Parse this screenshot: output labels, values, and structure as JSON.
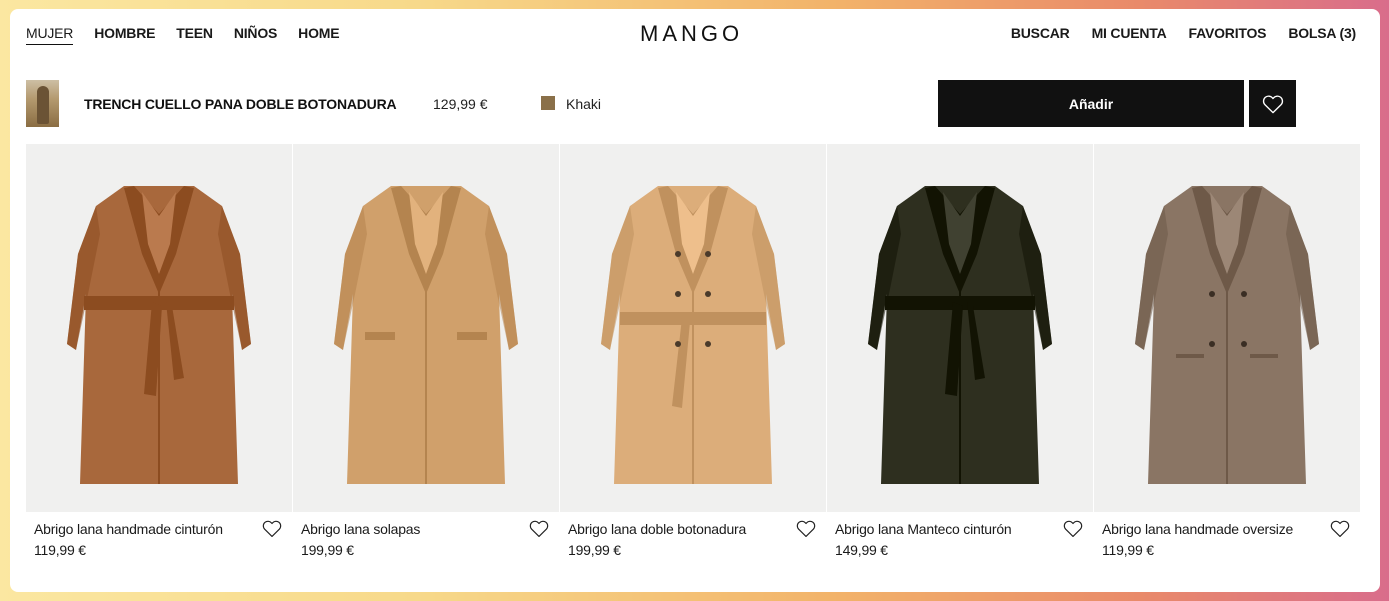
{
  "nav": {
    "left": [
      {
        "label": "MUJER",
        "active": true
      },
      {
        "label": "HOMBRE"
      },
      {
        "label": "TEEN"
      },
      {
        "label": "NIÑOS"
      },
      {
        "label": "HOME"
      }
    ],
    "logo": "MANGO",
    "right": [
      "BUSCAR",
      "MI CUENTA",
      "FAVORITOS",
      "BOLSA (3)"
    ]
  },
  "product_bar": {
    "title": "TRENCH CUELLO PANA DOBLE BOTONADURA",
    "price": "129,99 €",
    "color_name": "Khaki",
    "color_hex": "#8a7049",
    "add_label": "Añadir"
  },
  "products": [
    {
      "name": "Abrigo lana handmade cinturón",
      "price": "119,99 €",
      "color": "#a8683c",
      "style": "belted"
    },
    {
      "name": "Abrigo lana solapas",
      "price": "199,99 €",
      "color": "#d0a06b",
      "style": "open"
    },
    {
      "name": "Abrigo lana doble botonadura",
      "price": "199,99 €",
      "color": "#dcad7a",
      "style": "trench"
    },
    {
      "name": "Abrigo lana Manteco cinturón",
      "price": "149,99 €",
      "color": "#2e2f1f",
      "style": "belted"
    },
    {
      "name": "Abrigo lana handmade oversize",
      "price": "119,99 €",
      "color": "#8a7564",
      "style": "double"
    }
  ],
  "icons": {
    "favorite": "heart-outline-icon",
    "add_favorite": "heart-outline-icon"
  }
}
